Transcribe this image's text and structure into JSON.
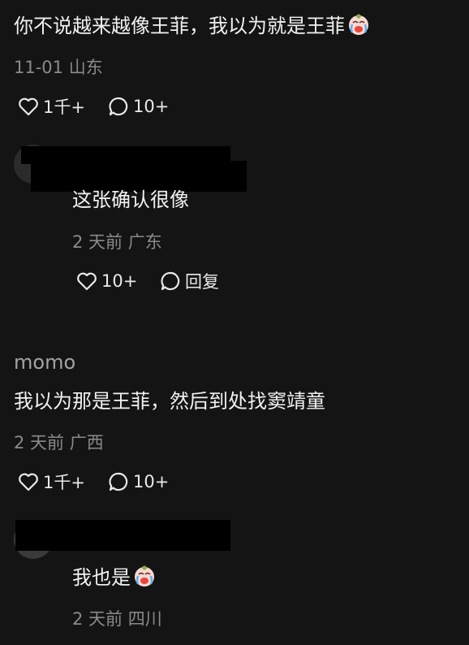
{
  "comments": [
    {
      "text": "你不说越来越像王菲，我以为就是王菲",
      "date_location": "11-01 山东",
      "likes": "1千+",
      "replies": "10+",
      "emoji_icon": "crying-face-emoji-icon"
    },
    {
      "text": "这张确认很像",
      "date_location": "2 天前 广东",
      "likes": "10+",
      "reply_label": "回复"
    },
    {
      "username": "momo",
      "text": "我以为那是王菲，然后到处找窦靖童",
      "date_location": "2 天前 广西",
      "likes": "1千+",
      "replies": "10+"
    },
    {
      "text": "我也是",
      "date_location": "2 天前 四川",
      "emoji_icon": "crying-face-emoji-icon"
    }
  ],
  "colors": {
    "background": "#141414",
    "text": "#f1f1f1",
    "meta": "#8a8a8a",
    "redaction": "#000000"
  }
}
